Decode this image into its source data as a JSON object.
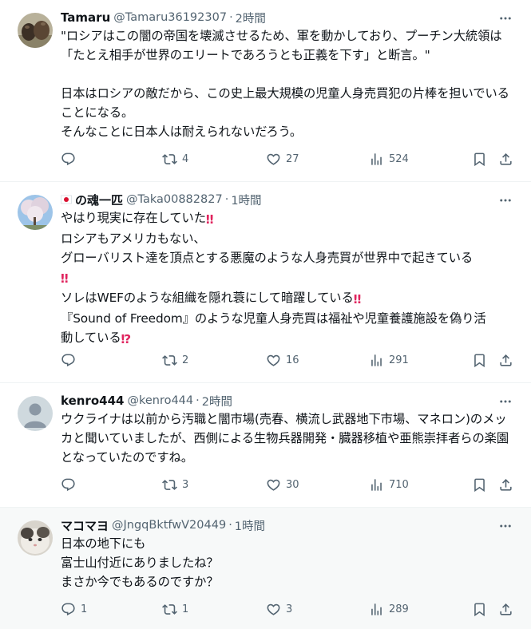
{
  "colors": {
    "accent": "#1d9bf0",
    "muted": "#536471",
    "text": "#0f1419",
    "emoji_red": "#e0245e"
  },
  "tweets": [
    {
      "name": "Tamaru",
      "handle": "@Tamaru36192307",
      "sep": "·",
      "time": "2時間",
      "avatar_icon": "cows-photo-avatar",
      "text": "\"ロシアはこの闇の帝国を壊滅させるため、軍を動かしており、プーチン大統領は「たとえ相手が世界のエリートであろうとも正義を下す」と断言。\"\n\n日本はロシアの敵だから、この史上最大規模の児童人身売買犯の片棒を担いでいることになる。\nそんなことに日本人は耐えられないだろう。",
      "replies": "",
      "retweets": "4",
      "likes": "27",
      "views": "524"
    },
    {
      "flag_icon": "japan-flag-icon",
      "name": "の魂一匹",
      "handle": "@Taka00882827",
      "sep": "·",
      "time": "1時間",
      "avatar_icon": "cherry-blossom-avatar",
      "lines": [
        "やはり現実に存在していた",
        "ロシアもアメリカもない、",
        "グローバリスト達を頂点とする悪魔のような人身売買が世界中で起きている",
        "ソレはWEFのような組織を隠れ蓑にして暗躍している",
        "『Sound of Freedom』のような児童人身売買は福祉や児童養護施設を偽り活",
        "動している"
      ],
      "emoji": {
        "bang": "‼",
        "interrobang": "⁉"
      },
      "replies": "",
      "retweets": "2",
      "likes": "16",
      "views": "291"
    },
    {
      "name": "kenro444",
      "handle": "@kenro444",
      "sep": "·",
      "time": "2時間",
      "avatar_icon": "default-user-avatar",
      "text": "ウクライナは以前から汚職と闇市場(売春、横流し武器地下市場、マネロン)のメッカと聞いていましたが、西側による生物兵器開発・臓器移植や亜熊崇拝者らの楽園となっていたのですね。",
      "replies": "",
      "retweets": "3",
      "likes": "30",
      "views": "710"
    },
    {
      "name": "マコマヨ",
      "handle": "@JngqBktfwV20449",
      "sep": "·",
      "time": "1時間",
      "avatar_icon": "cat-photo-avatar",
      "text": "日本の地下にも\n富士山付近にありましたね？\nまさか今でもあるのですか？",
      "replies": "1",
      "retweets": "1",
      "likes": "3",
      "views": "289"
    }
  ]
}
